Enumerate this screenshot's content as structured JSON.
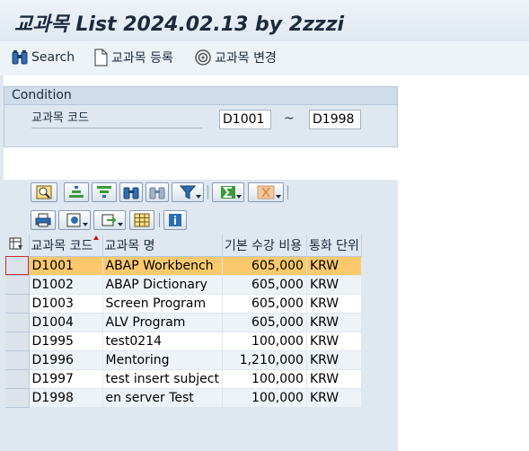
{
  "window": {
    "title": "교과목 List 2024.02.13 by 2zzzi"
  },
  "toolbar": {
    "search_label": "Search",
    "register_label": "교과목 등록",
    "change_label": "교과목 변경"
  },
  "condition": {
    "header": "Condition",
    "field_label": "교과목 코드",
    "from_value": "D1001",
    "separator": "~",
    "to_value": "D1998"
  },
  "alv_toolbar": {
    "row1": [
      "details-icon",
      "sort-ascending-icon",
      "sort-descending-icon",
      "find-icon",
      "find-next-icon",
      "filter-icon",
      "total-icon",
      "subtotal-icon"
    ],
    "row2": [
      "print-icon",
      "views-icon",
      "export-icon",
      "layout-icon",
      "information-icon"
    ]
  },
  "grid": {
    "columns": [
      "교과목 코드",
      "교과목 명",
      "기본 수강 비용",
      "통화 단위"
    ],
    "sorted_column": "교과목 코드",
    "rows": [
      {
        "code": "D1001",
        "name": "ABAP Workbench",
        "cost": "605,000",
        "currency": "KRW",
        "selected": true
      },
      {
        "code": "D1002",
        "name": "ABAP Dictionary",
        "cost": "605,000",
        "currency": "KRW"
      },
      {
        "code": "D1003",
        "name": "Screen Program",
        "cost": "605,000",
        "currency": "KRW"
      },
      {
        "code": "D1004",
        "name": "ALV Program",
        "cost": "605,000",
        "currency": "KRW"
      },
      {
        "code": "D1995",
        "name": "test0214",
        "cost": "100,000",
        "currency": "KRW"
      },
      {
        "code": "D1996",
        "name": "Mentoring",
        "cost": "1,210,000",
        "currency": "KRW"
      },
      {
        "code": "D1997",
        "name": "test insert subject",
        "cost": "100,000",
        "currency": "KRW"
      },
      {
        "code": "D1998",
        "name": "en server Test",
        "cost": "100,000",
        "currency": "KRW"
      }
    ]
  },
  "colors": {
    "title_bg": "#dfe8f1",
    "header_bg": "#dfe8f1",
    "selected_row": "#fbc96c",
    "alt_row": "#eef3f8"
  }
}
